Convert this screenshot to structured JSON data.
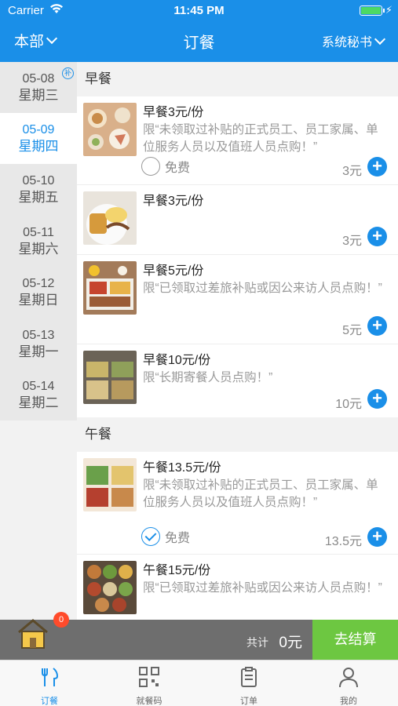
{
  "status_bar": {
    "carrier": "Carrier",
    "time": "11:45 PM"
  },
  "nav": {
    "left_label": "本部",
    "title": "订餐",
    "right_label": "系统秘书"
  },
  "dates": [
    {
      "date": "05-08",
      "weekday": "星期三",
      "badge": "补",
      "active": false
    },
    {
      "date": "05-09",
      "weekday": "星期四",
      "active": true
    },
    {
      "date": "05-10",
      "weekday": "星期五",
      "active": false
    },
    {
      "date": "05-11",
      "weekday": "星期六",
      "active": false
    },
    {
      "date": "05-12",
      "weekday": "星期日",
      "active": false
    },
    {
      "date": "05-13",
      "weekday": "星期一",
      "active": false
    },
    {
      "date": "05-14",
      "weekday": "星期二",
      "active": false
    }
  ],
  "sections": {
    "breakfast": {
      "title": "早餐",
      "items": [
        {
          "name": "早餐3元/份",
          "desc": "限“未领取过补贴的正式员工、员工家属、单位服务人员以及值班人员点购！”",
          "free_label": "免费",
          "price": "3元"
        },
        {
          "name": "早餐3元/份",
          "desc": "",
          "price": "3元"
        },
        {
          "name": "早餐5元/份",
          "desc": "限“已领取过差旅补贴或因公来访人员点购！”",
          "price": "5元"
        },
        {
          "name": "早餐10元/份",
          "desc": "限“长期寄餐人员点购！”",
          "price": "10元"
        }
      ]
    },
    "lunch": {
      "title": "午餐",
      "items": [
        {
          "name": "午餐13.5元/份",
          "desc": "限“未领取过补贴的正式员工、员工家属、单位服务人员以及值班人员点购！”",
          "free_label": "免费",
          "price": "13.5元"
        },
        {
          "name": "午餐15元/份",
          "desc": "限“已领取过差旅补贴或因公来访人员点购！”"
        }
      ]
    }
  },
  "checkout": {
    "cart_count": "0",
    "total_label": "共计",
    "total_value": "0元",
    "button_label": "去结算"
  },
  "tabs": [
    {
      "label": "订餐",
      "icon": "utensils-icon",
      "active": true
    },
    {
      "label": "就餐码",
      "icon": "qr-code-icon",
      "active": false
    },
    {
      "label": "订单",
      "icon": "clipboard-icon",
      "active": false
    },
    {
      "label": "我的",
      "icon": "person-icon",
      "active": false
    }
  ],
  "colors": {
    "primary": "#1a8fe8",
    "checkout_green": "#6dc741",
    "badge_red": "#ff4b2b"
  }
}
